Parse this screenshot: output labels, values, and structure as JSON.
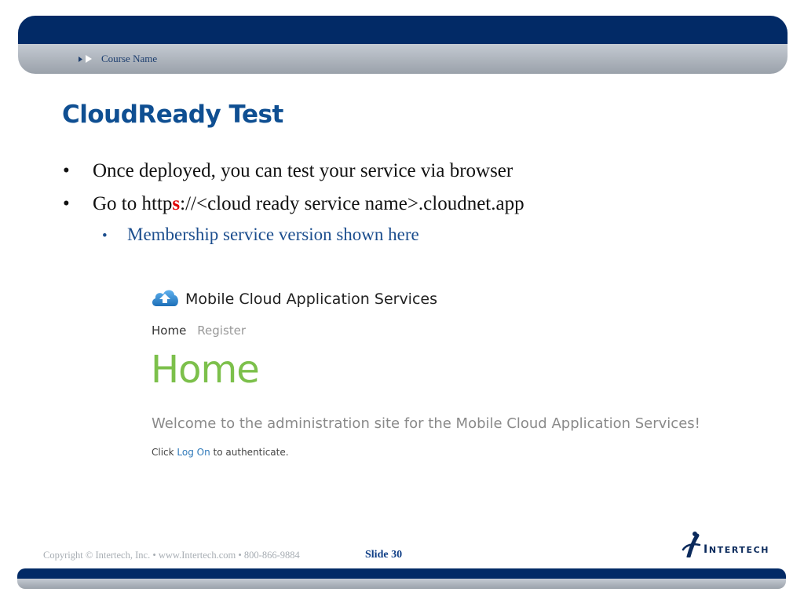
{
  "header": {
    "course_name": "Course Name"
  },
  "slide": {
    "title": "CloudReady Test",
    "bullets": {
      "b1": "Once deployed, you can test your service via browser",
      "b2_prefix": "Go to http",
      "b2_highlight": "s",
      "b2_suffix": "://<cloud ready service name>.cloudnet.app",
      "b3": "Membership service version shown here"
    }
  },
  "screenshot": {
    "app_title": "Mobile Cloud Application Services",
    "nav": {
      "home": "Home",
      "register": "Register"
    },
    "heading": "Home",
    "welcome": "Welcome to the administration site for the Mobile Cloud Application Services!",
    "click_prefix": "Click ",
    "click_link": "Log On",
    "click_suffix": " to authenticate."
  },
  "footer": {
    "copyright": "Copyright © Intertech, Inc. • www.Intertech.com • 800-866-9884",
    "slide_number": "Slide 30",
    "logo_text_first": "I",
    "logo_text_rest": "NTERTECH"
  },
  "colors": {
    "navy": "#022a66",
    "title_blue": "#0f4f92",
    "accent_red": "#e00000",
    "green": "#7cc04b",
    "link_blue": "#2f79b9"
  },
  "icons": {
    "header_arrows": "double-arrow-icon",
    "app_icon": "cloud-upload-icon",
    "logo": "intertech-logo"
  }
}
